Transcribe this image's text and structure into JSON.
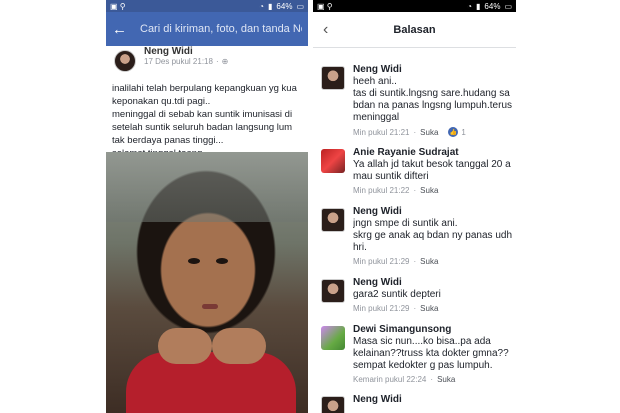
{
  "left": {
    "status": {
      "battery": "64%"
    },
    "search": {
      "placeholder": "Cari di kiriman, foto, dan tanda Ne"
    },
    "post": {
      "author": "Neng Widi",
      "timestamp": "17 Des pukul 21:18",
      "text": "inalilahi telah berpulang kepangkuan yg kua\nkeponakan qu.tdi pagi..\nmeninggal di sebab kan suntik imunisasi di\nsetelah suntik seluruh badan langsung lum\ntak berdaya panas tinggi...\nselamat tinggal toang...."
    }
  },
  "right": {
    "status": {
      "battery": "64%"
    },
    "header": {
      "title": "Balasan"
    },
    "comments": [
      {
        "name": "Neng Widi",
        "text": "heeh ani..\ntas di suntik.lngsng sare.hudang sa\nbdan na panas lngsng lumpuh.terus\nmeninggal",
        "time": "Min pukul 21:21",
        "like": "Suka",
        "reactions": "1"
      },
      {
        "name": "Anie Rayanie Sudrajat",
        "text": "Ya allah jd takut besok tanggal 20 a\nmau suntik difteri",
        "time": "Min pukul 21:22",
        "like": "Suka"
      },
      {
        "name": "Neng Widi",
        "text": "jngn smpe di suntik ani.\nskrg ge anak aq bdan ny panas udh\nhri.",
        "time": "Min pukul 21:29",
        "like": "Suka"
      },
      {
        "name": "Neng Widi",
        "text": "gara2 suntik depteri",
        "time": "Min pukul 21:29",
        "like": "Suka"
      },
      {
        "name": "Dewi Simangunsong",
        "text": "Masa sic nun....ko bisa..pa ada\nkelainan??truss kta dokter gmna??\nsempat kedokter g pas lumpuh.",
        "time": "Kemarin pukul 22:24",
        "like": "Suka"
      },
      {
        "name": "Neng Widi"
      }
    ]
  },
  "separator": "·"
}
